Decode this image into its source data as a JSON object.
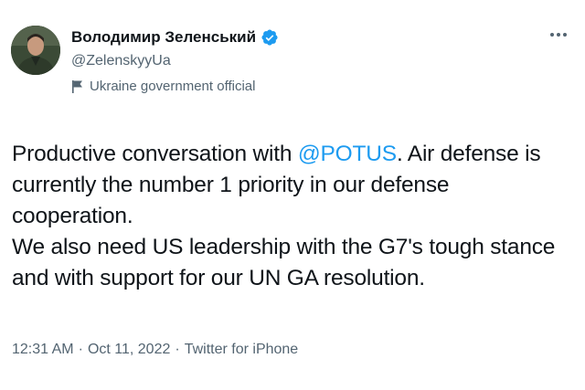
{
  "author": {
    "display_name": "Володимир Зеленський",
    "handle": "@ZelenskyyUa",
    "label": "Ukraine government official",
    "verified_icon": "verified-badge-icon",
    "label_icon": "flag-icon",
    "avatar_icon": "profile-photo"
  },
  "menu": {
    "more_icon": "more-options-icon"
  },
  "tweet": {
    "line1_before": "Productive conversation with ",
    "line1_mention": "@POTUS",
    "line1_after": ". Air defense is",
    "line2": "currently the number 1 priority in our defense",
    "line3": "cooperation.",
    "line4": "We also need US leadership with the G7's tough stance",
    "line5": "and with support for our UN GA resolution."
  },
  "meta": {
    "time": "12:31 AM",
    "date": "Oct 11, 2022",
    "source": "Twitter for iPhone",
    "separator": "·"
  },
  "colors": {
    "link": "#1d9bf0",
    "text": "#0f1419",
    "secondary": "#536471"
  }
}
